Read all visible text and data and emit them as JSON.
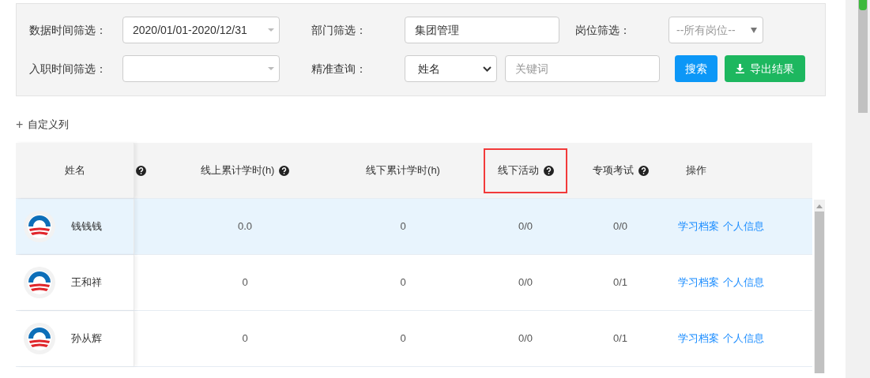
{
  "filters": [
    [
      {
        "kind": "dropdown",
        "label": "数据时间筛选：",
        "value": "2020/01/01-2020/12/31"
      },
      {
        "kind": "text",
        "label": "部门筛选：",
        "value": "集团管理"
      },
      {
        "kind": "select",
        "label": "岗位筛选：",
        "placeholder": "--所有岗位--"
      }
    ],
    [
      {
        "kind": "dropdown",
        "label": "入职时间筛选："
      },
      {
        "kind": "search",
        "label": "精准查询：",
        "select_value": "姓名",
        "placeholder": "关键词"
      }
    ]
  ],
  "buttons": [
    {
      "kind": "primary",
      "label": "搜索"
    },
    {
      "kind": "export",
      "label": "导出结果"
    }
  ],
  "add_column": {
    "icon": "+",
    "label": "自定义列"
  },
  "table": {
    "columns": [
      {
        "label": "姓名",
        "help": false,
        "highlighted": false
      },
      {
        "help": true,
        "highlighted": false
      },
      {
        "label": "线上累计学时(h)",
        "help": true,
        "highlighted": false
      },
      {
        "label": "线下累计学时(h)",
        "help": false,
        "highlighted": false
      },
      {
        "label": "线下活动",
        "help": true,
        "highlighted": true
      },
      {
        "label": "专项考试",
        "help": true,
        "highlighted": false
      },
      {
        "label": "操作",
        "help": false,
        "highlighted": false
      }
    ],
    "rows": [
      {
        "selected": true,
        "cells": [
          "钱钱钱",
          "",
          "0.0",
          "0",
          "0/0",
          "0/0"
        ],
        "actions": [
          "学习档案",
          "个人信息"
        ]
      },
      {
        "selected": false,
        "cells": [
          "王和祥",
          "",
          "0",
          "0",
          "0/0",
          "0/1"
        ],
        "actions": [
          "学习档案",
          "个人信息"
        ]
      },
      {
        "selected": false,
        "cells": [
          "孙从辉",
          "",
          "0",
          "0",
          "0/0",
          "0/1"
        ],
        "actions": [
          "学习档案",
          "个人信息"
        ]
      }
    ]
  }
}
